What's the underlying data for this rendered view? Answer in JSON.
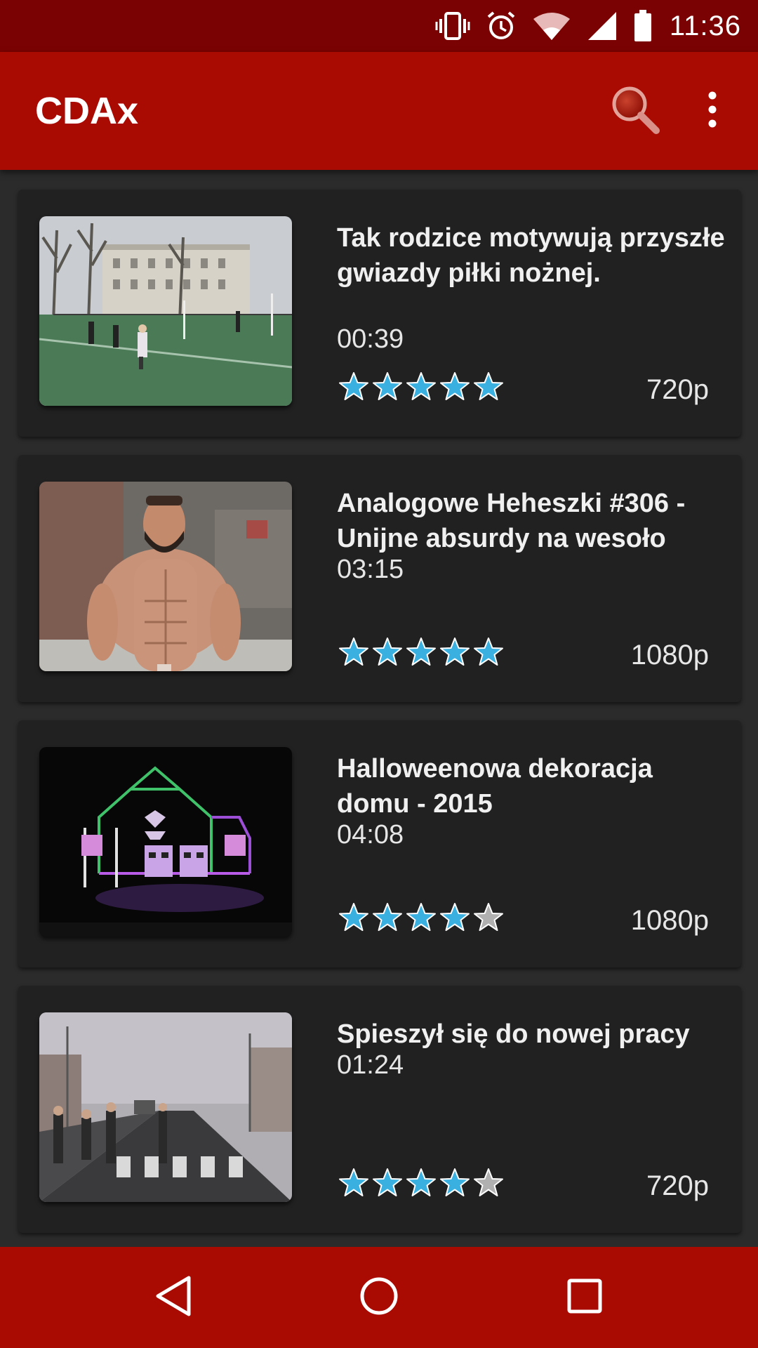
{
  "status_bar": {
    "time": "11:36",
    "icons": [
      "vibrate-icon",
      "alarm-icon",
      "wifi-icon",
      "signal-icon",
      "battery-icon"
    ]
  },
  "app_bar": {
    "title": "CDAx",
    "actions": [
      "search-icon",
      "overflow-menu-icon"
    ]
  },
  "videos": [
    {
      "title": "Tak rodzice motywują przyszłe gwiazdy piłki nożnej.",
      "duration": "00:39",
      "rating": 5,
      "quality": "720p"
    },
    {
      "title": "Analogowe Heheszki #306 - Unijne absurdy na wesoło",
      "duration": "03:15",
      "rating": 5,
      "quality": "1080p"
    },
    {
      "title": "Halloweenowa dekoracja domu - 2015",
      "duration": "04:08",
      "rating": 4,
      "quality": "1080p"
    },
    {
      "title": "Spieszył się do nowej pracy",
      "duration": "01:24",
      "rating": 4,
      "quality": "720p"
    }
  ],
  "nav_bar": {
    "buttons": [
      "back-icon",
      "home-icon",
      "recents-icon"
    ]
  },
  "colors": {
    "status_bar": "#7a0202",
    "app_bar": "#a90a02",
    "star_filled": "#3ab0e0",
    "star_empty": "#b0b0b0",
    "card": "#212121",
    "background": "#2b2b2b"
  }
}
